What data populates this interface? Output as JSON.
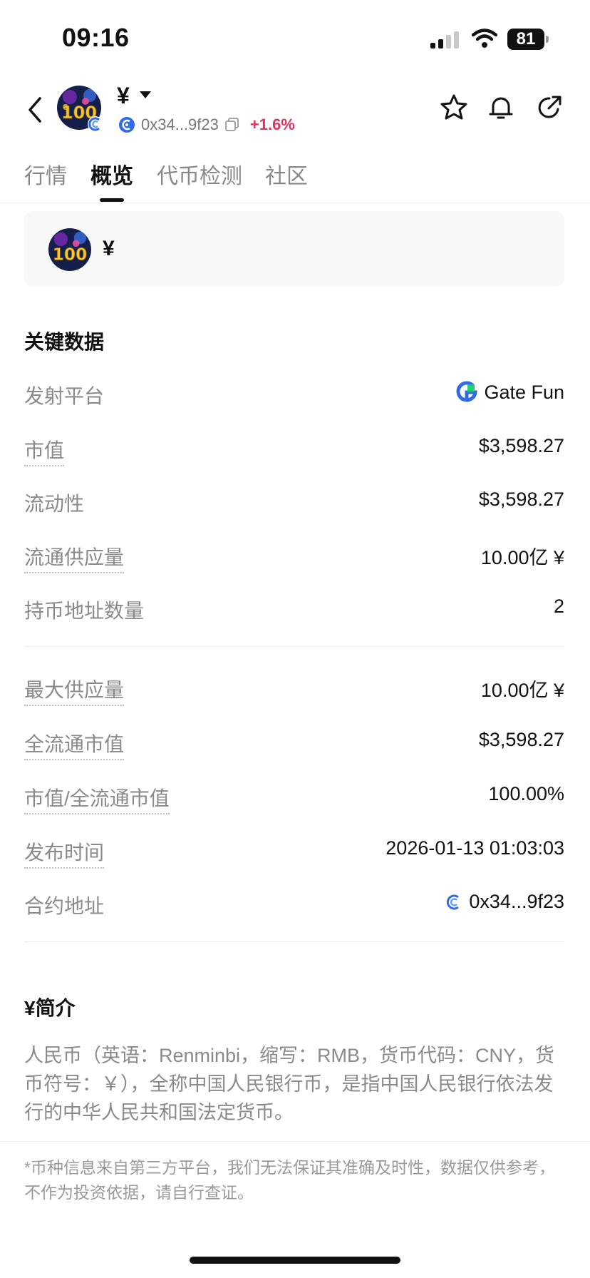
{
  "status_bar": {
    "time": "09:16",
    "battery": "81"
  },
  "header": {
    "coin_name": "¥",
    "short_address": "0x34...9f23",
    "change": "+1.6%",
    "icons": [
      "back-arrow-icon",
      "star-icon",
      "bell-icon",
      "share-icon",
      "copy-icon",
      "chain-icon"
    ]
  },
  "tabs": [
    {
      "label": "行情"
    },
    {
      "label": "概览"
    },
    {
      "label": "代币检测"
    },
    {
      "label": "社区"
    }
  ],
  "active_tab": "概览",
  "token_card": {
    "name": "¥"
  },
  "key_data": {
    "title": "关键数据",
    "rows": [
      {
        "label": "发射平台",
        "value": "Gate Fun"
      },
      {
        "label": "市值",
        "value": "$3,598.27"
      },
      {
        "label": "流动性",
        "value": "$3,598.27"
      },
      {
        "label": "流通供应量",
        "value": "10.00亿 ¥"
      },
      {
        "label": "持币地址数量",
        "value": "2"
      },
      {
        "label": "最大供应量",
        "value": "10.00亿 ¥"
      },
      {
        "label": "全流通市值",
        "value": "$3,598.27"
      },
      {
        "label": "市值/全流通市值",
        "value": "100.00%"
      },
      {
        "label": "发布时间",
        "value": "2026-01-13 01:03:03"
      },
      {
        "label": "合约地址",
        "value": "0x34...9f23"
      }
    ]
  },
  "intro": {
    "title": "¥简介",
    "text": "人民币（英语：Renminbi，缩写：RMB，货币代码：CNY，货币符号：￥），全称中国人民银行币，是指中国人民银行依法发行的中华人民共和国法定货币。"
  },
  "disclaimer": "*币种信息来自第三方平台，我们无法保证其准确及时性，数据仅供参考，不作为投资依据，请自行查证。",
  "colors": {
    "accent_positive": "#e0325e",
    "chain_blue": "#2f6be6",
    "gate_green": "#1fd36c"
  }
}
